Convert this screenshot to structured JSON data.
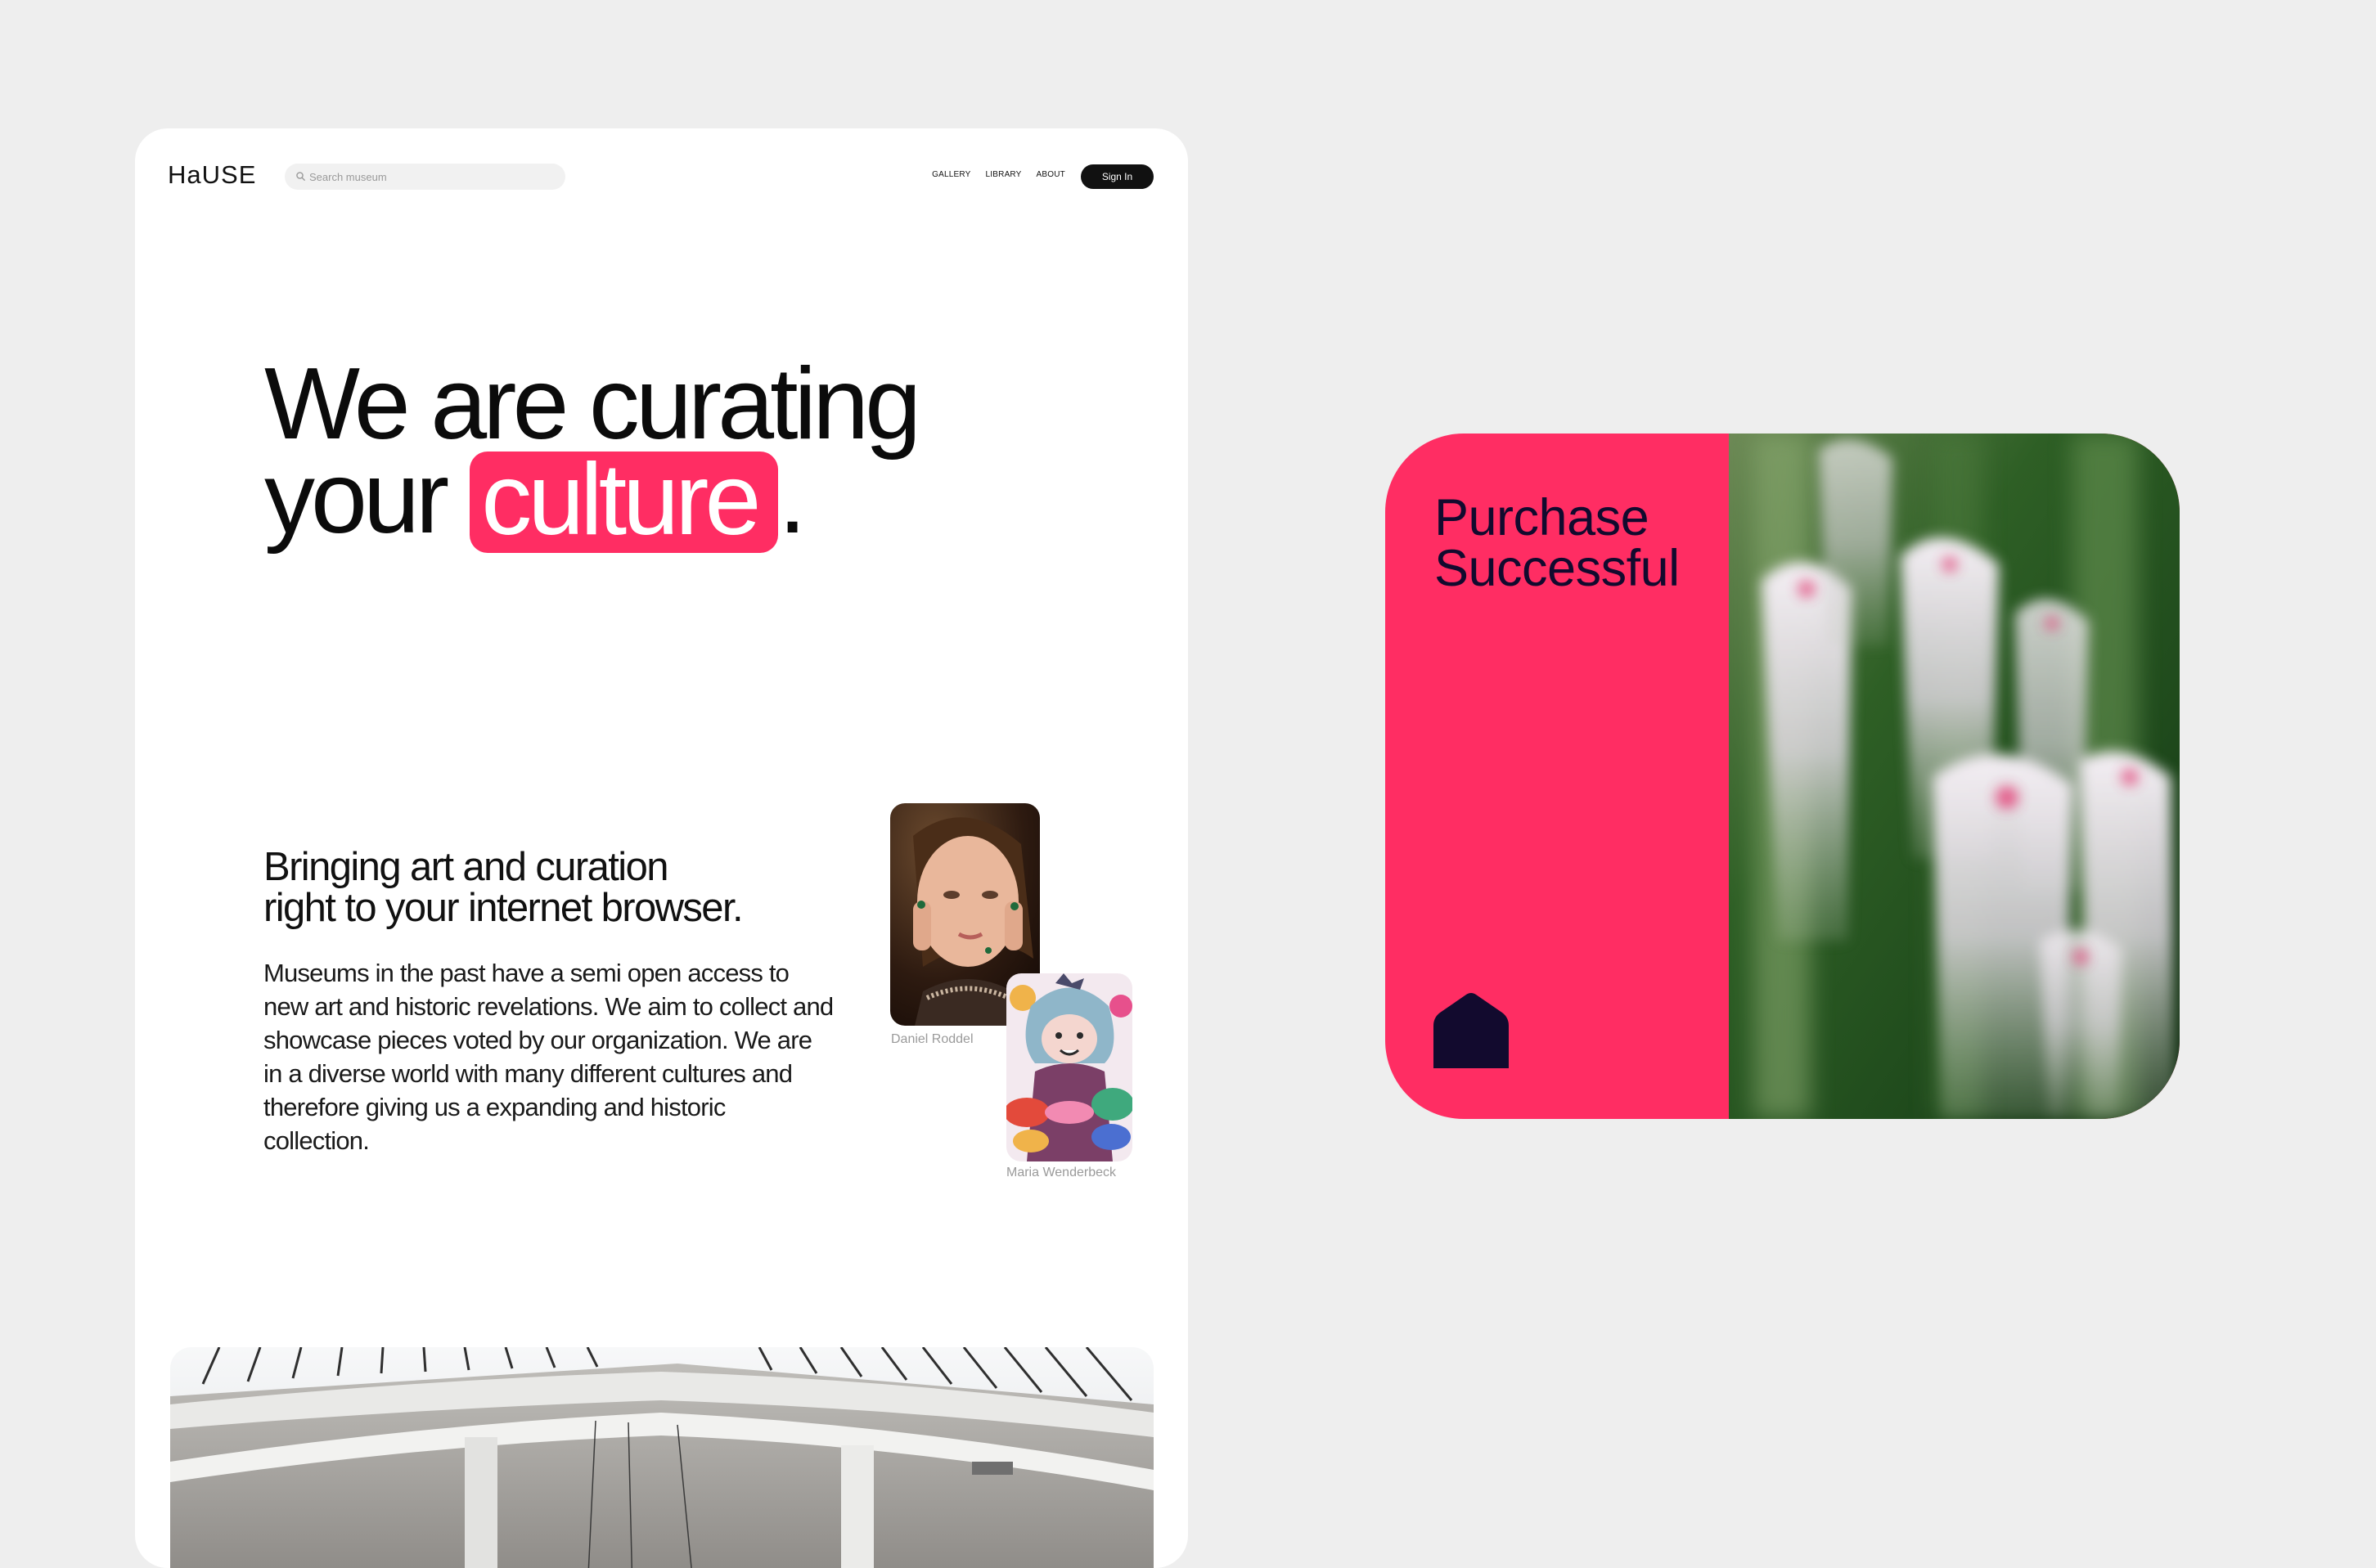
{
  "site": {
    "logo": "HaUSE",
    "search": {
      "placeholder": "Search museum"
    },
    "nav": [
      {
        "label": "GALLERY"
      },
      {
        "label": "LIBRARY"
      },
      {
        "label": "ABOUT"
      }
    ],
    "signin_label": "Sign In",
    "hero": {
      "line1": "We are curating",
      "line2_prefix": "your",
      "highlight": "culture",
      "suffix": "."
    },
    "section": {
      "title_line1": "Bringing art and curation",
      "title_line2": "right to your internet browser.",
      "body": "Museums in the past have a semi open access to new art and historic revelations. We aim to collect and showcase pieces voted by our organization. We are in a diverse world with many different cultures and therefore giving us a expanding and historic collection."
    },
    "artworks": [
      {
        "caption": "Daniel Roddel"
      },
      {
        "caption": "Maria Wenderbeck"
      }
    ]
  },
  "purchase": {
    "title_line1": "Purchase",
    "title_line2": "Successful"
  },
  "colors": {
    "accent": "#ff2d63",
    "dark": "#120a2e",
    "background": "#eeeeee",
    "card": "#ffffff"
  },
  "icons": [
    "search-icon",
    "house-icon"
  ]
}
